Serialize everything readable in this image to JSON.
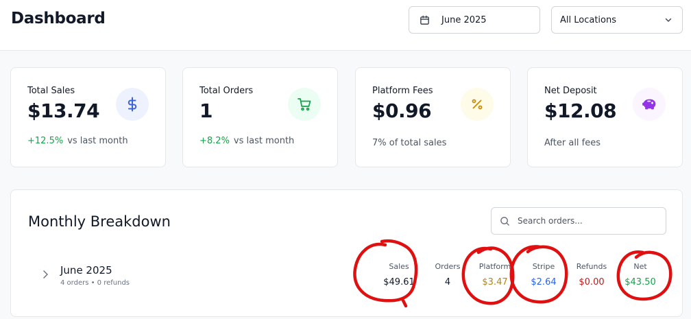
{
  "header": {
    "title": "Dashboard",
    "date_picker": {
      "value": "June 2025",
      "icon": "calendar-icon"
    },
    "location_select": {
      "value": "All Locations",
      "icon": "chevron-down-icon"
    }
  },
  "cards": [
    {
      "label": "Total Sales",
      "value": "$13.74",
      "change": "+12.5%",
      "footer": "vs last month",
      "icon": "dollar-icon",
      "icon_color": "#3b63d6",
      "icon_bg": "#eef2ff"
    },
    {
      "label": "Total Orders",
      "value": "1",
      "change": "+8.2%",
      "footer": "vs last month",
      "icon": "cart-icon",
      "icon_color": "#16a34a",
      "icon_bg": "#ecfdf3"
    },
    {
      "label": "Platform Fees",
      "value": "$0.96",
      "footer": "7% of total sales",
      "icon": "percent-icon",
      "icon_color": "#ca8a04",
      "icon_bg": "#fefce8"
    },
    {
      "label": "Net Deposit",
      "value": "$12.08",
      "footer": "After all fees",
      "icon": "piggy-bank-icon",
      "icon_color": "#9333ea",
      "icon_bg": "#faf5ff"
    }
  ],
  "breakdown": {
    "title": "Monthly Breakdown",
    "search_placeholder": "Search orders...",
    "rows": [
      {
        "month": "June 2025",
        "subtitle": "4 orders • 0 refunds",
        "columns": [
          {
            "header": "Sales",
            "value": "$49.61",
            "color": "#111827"
          },
          {
            "header": "Orders",
            "value": "4",
            "color": "#111827"
          },
          {
            "header": "Platform",
            "value": "$3.47",
            "color": "#b7860b"
          },
          {
            "header": "Stripe",
            "value": "$2.64",
            "color": "#2563eb"
          },
          {
            "header": "Refunds",
            "value": "$0.00",
            "color": "#b91c1c"
          },
          {
            "header": "Net",
            "value": "$43.50",
            "color": "#16a34a"
          }
        ]
      }
    ]
  },
  "colors": {
    "annotation": "#e01010",
    "positive": "#16a34a"
  }
}
